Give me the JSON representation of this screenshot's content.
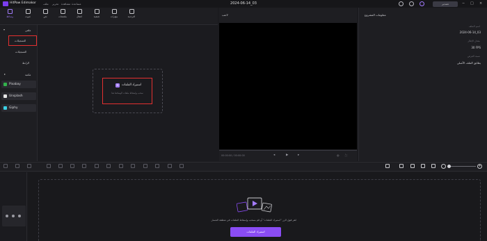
{
  "app": {
    "name": "HitPaw Edimakor",
    "doc_title": "2024-06-14_03"
  },
  "menu": [
    "ملف",
    "تحرير",
    "مشاهدة",
    "مساعدة"
  ],
  "titlebar": {
    "export_label": "تصدير"
  },
  "toolbar": [
    {
      "label": "وسائط",
      "icon": "media-icon",
      "active": true
    },
    {
      "label": "صوت",
      "icon": "audio-icon"
    },
    {
      "label": "نص",
      "icon": "text-icon"
    },
    {
      "label": "ملصقات",
      "icon": "sticker-icon"
    },
    {
      "label": "انتقال",
      "icon": "transition-icon"
    },
    {
      "label": "تصفية",
      "icon": "filter-icon"
    },
    {
      "label": "مؤثرات",
      "icon": "effects-icon"
    },
    {
      "label": "الترجمة",
      "icon": "subtitle-icon"
    }
  ],
  "leftnav": {
    "section_project": "ملفي",
    "item_local": "التسجيلات",
    "item_recordings": "التسجيلات",
    "item_cloud": "الرابط",
    "section_library": "مكتبة",
    "sources": [
      {
        "name": "Pixabay",
        "color": "#33b24c"
      },
      {
        "name": "Unsplash",
        "color": "#e6e6e6"
      },
      {
        "name": "Giphy",
        "color": "#3bd1e6"
      }
    ]
  },
  "media": {
    "import_label": "استيراد الملفات",
    "import_hint": "سحب وإسقاط ملفات الوسائط هنا"
  },
  "player": {
    "title": "لاعب",
    "timecode": "00:00:00 / 00:00:00"
  },
  "properties": {
    "title": "معلومات المشروع",
    "fields": [
      {
        "key": "اسم الملف",
        "value": "2024-06-14_03"
      },
      {
        "key": "معدل الإطار",
        "value": "30 FPS"
      },
      {
        "key": "نسبة العرض",
        "value": "يطابق الملف الأصلي"
      }
    ]
  },
  "timeline": {
    "hint": "انقر فوق الزر \"استيراد الملفات\" أو قم بسحب وإسقاط الملفات في منطقة المسار",
    "import_button": "استيراد الملفات"
  }
}
